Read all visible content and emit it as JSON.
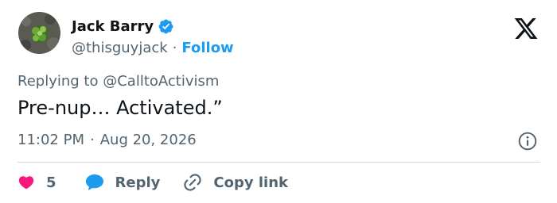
{
  "author": {
    "name": "Jack Barry",
    "handle": "@thisguyjack",
    "separator": "·",
    "follow_label": "Follow"
  },
  "reply_context": {
    "prefix": "Replying to",
    "mention": "@CalltoActivism"
  },
  "tweet": {
    "text": "Pre-nup… Activated.”",
    "time": "11:02 PM",
    "separator": "·",
    "date": "Aug 20, 2026"
  },
  "actions": {
    "like_count": "5",
    "reply_label": "Reply",
    "copy_link_label": "Copy link"
  },
  "colors": {
    "accent": "#1d9bf0",
    "like": "#f91880",
    "text": "#0f1419",
    "muted": "#536471"
  },
  "icons": [
    "verified-badge-icon",
    "x-logo-icon",
    "info-icon",
    "heart-icon",
    "reply-bubble-icon",
    "link-icon"
  ]
}
